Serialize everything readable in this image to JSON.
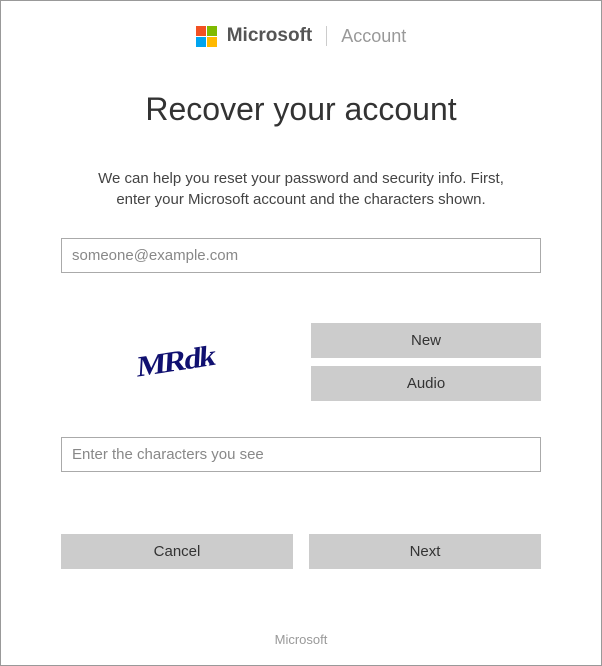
{
  "header": {
    "brand": "Microsoft",
    "section": "Account"
  },
  "page": {
    "title": "Recover your account",
    "description": "We can help you reset your password and security info. First, enter your Microsoft account and the characters shown."
  },
  "form": {
    "account_placeholder": "someone@example.com",
    "captcha_value": "MRdk",
    "captcha_new_label": "New",
    "captcha_audio_label": "Audio",
    "captcha_input_placeholder": "Enter the characters you see",
    "cancel_label": "Cancel",
    "next_label": "Next"
  },
  "footer": {
    "text": "Microsoft"
  }
}
